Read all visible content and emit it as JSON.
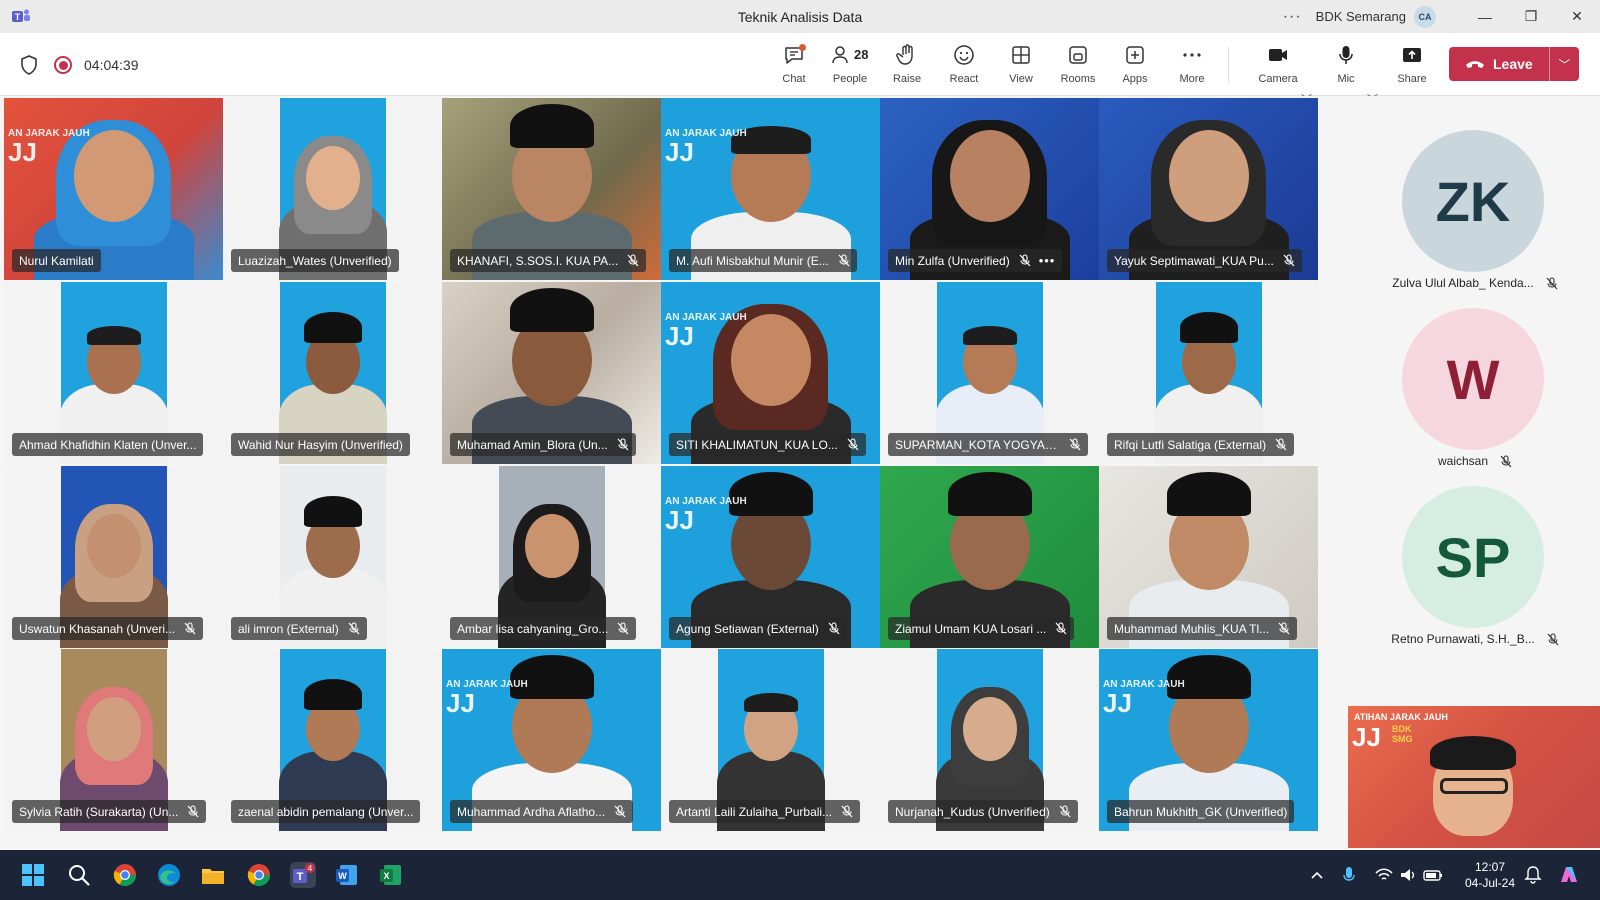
{
  "window": {
    "title": "Teknik Analisis Data",
    "org": "BDK Semarang",
    "avatar_initials": "CA",
    "more": "···",
    "minimize": "—",
    "maximize": "❐",
    "close": "✕"
  },
  "meeting": {
    "timer": "04:04:39",
    "people_count": "28",
    "tools": {
      "chat": "Chat",
      "people": "People",
      "raise": "Raise",
      "react": "React",
      "view": "View",
      "rooms": "Rooms",
      "apps": "Apps",
      "more": "More",
      "camera": "Camera",
      "mic": "Mic",
      "share": "Share"
    },
    "leave": "Leave"
  },
  "tiles": [
    {
      "name": "Nurul Kamilati"
    },
    {
      "name": "Luazizah_Wates (Unverified)"
    },
    {
      "name": "KHANAFI, S.SOS.I. KUA PA..."
    },
    {
      "name": "M. Aufi Misbakhul Munir (E..."
    },
    {
      "name": "Min Zulfa (Unverified)"
    },
    {
      "name": "Yayuk Septimawati_KUA Pu..."
    },
    {
      "name": "Ahmad Khafidhin Klaten (Unver..."
    },
    {
      "name": "Wahid Nur Hasyim (Unverified)"
    },
    {
      "name": "Muhamad Amin_Blora (Un..."
    },
    {
      "name": "SITI KHALIMATUN_KUA LO..."
    },
    {
      "name": "SUPARMAN_KOTA YOGYAK..."
    },
    {
      "name": "Rifqi Lutfi Salatiga (External)"
    },
    {
      "name": "Uswatun Khasanah (Unveri..."
    },
    {
      "name": "ali imron (External)"
    },
    {
      "name": "Ambar lisa cahyaning_Gro..."
    },
    {
      "name": "Agung Setiawan (External)"
    },
    {
      "name": "Ziamul Umam KUA Losari ..."
    },
    {
      "name": "Muhammad Muhlis_KUA Tl..."
    },
    {
      "name": "Sylvia Ratih (Surakarta) (Un..."
    },
    {
      "name": "zaenal abidin pemalang (Unver..."
    },
    {
      "name": "Muhammad Ardha Aflatho..."
    },
    {
      "name": "Artanti Laili Zulaiha_Purbali..."
    },
    {
      "name": "Nurjanah_Kudus (Unverified)"
    },
    {
      "name": "Bahrun Mukhith_GK (Unverified)"
    }
  ],
  "brand": {
    "line1": "AN JARAK JAUH",
    "big": "JJ",
    "tag": "BDK SMG",
    "self_line": "ATIHAN JARAK JAUH"
  },
  "side_people": [
    {
      "initials": "ZK",
      "name": "Zulva Ulul Albab_ Kenda..."
    },
    {
      "initials": "W",
      "name": "waichsan"
    },
    {
      "initials": "SP",
      "name": "Retno Purnawati, S.H._B..."
    }
  ],
  "clock": {
    "time": "12:07",
    "date": "04-Jul-24"
  },
  "colors": {
    "leave": "#c4314b",
    "accent": "#6264a7",
    "taskbar": "#1c2537"
  }
}
